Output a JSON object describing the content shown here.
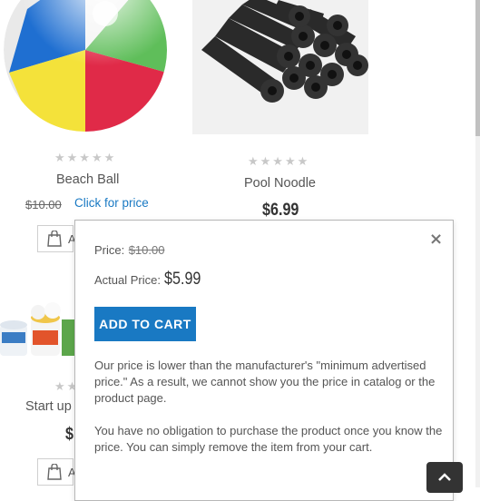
{
  "products": [
    {
      "name": "Beach Ball",
      "rating_stars": "★★★★★",
      "old_price": "$10.00",
      "price_link": "Click for price"
    },
    {
      "name": "Pool Noodle",
      "rating_stars": "★★★★★",
      "price": "$6.99"
    },
    {
      "name": "Start up",
      "rating_stars": "★★★★★",
      "price_partial": "$"
    }
  ],
  "cart_button_partial": "A",
  "popup": {
    "price_label": "Price:",
    "price_old": "$10.00",
    "actual_label": "Actual Price:",
    "actual_value": "$5.99",
    "add_to_cart": "ADD TO CART",
    "notice_1": "Our price is lower than the manufacturer's \"minimum advertised price.\" As a result, we cannot show you the price in catalog or the product page.",
    "notice_2": "You have no obligation to purchase the product once you know the price. You can simply remove the item from your cart.",
    "close_icon": "×"
  },
  "icons": {
    "cart": "shopping-bag-icon",
    "close": "close-icon",
    "back_to_top": "chevron-up-icon"
  },
  "colors": {
    "accent": "#1979c3",
    "star": "#c8c8c8",
    "back_top_bg": "#333333"
  }
}
